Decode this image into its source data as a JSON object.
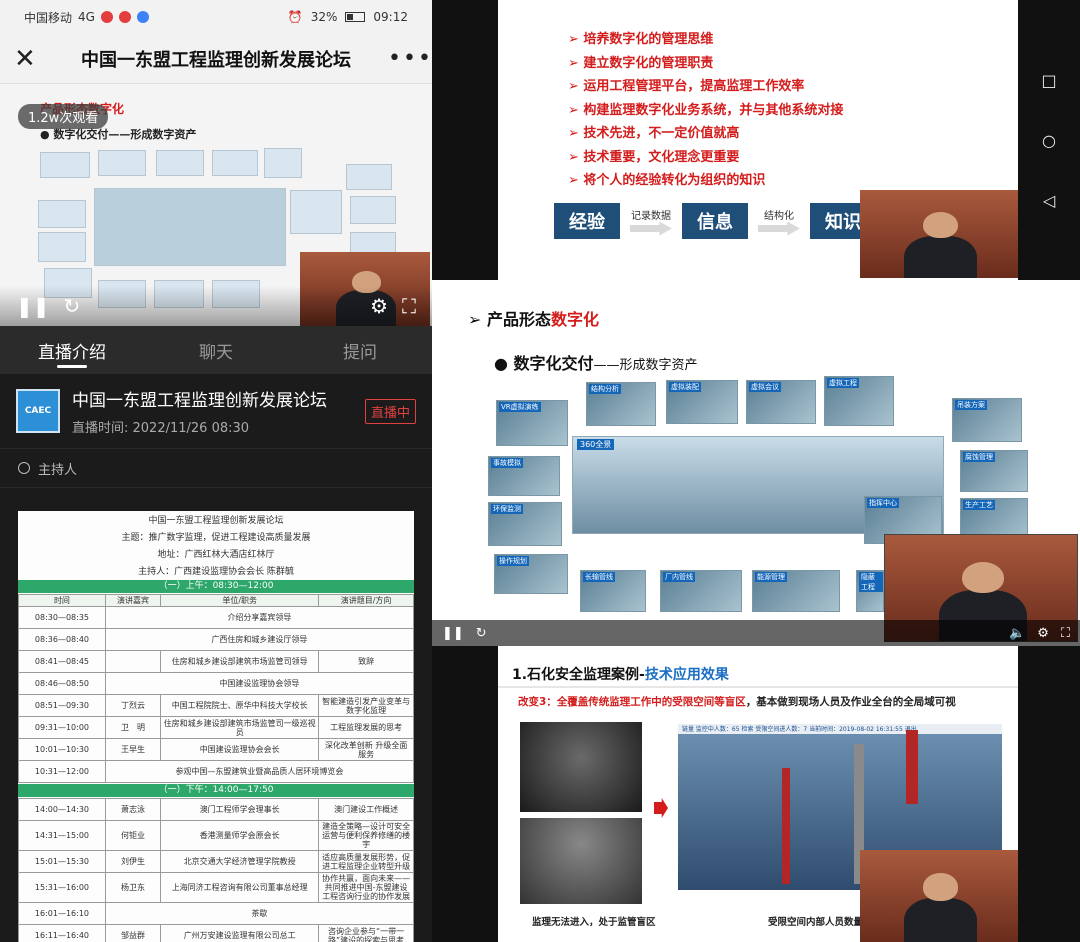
{
  "status_bar": {
    "carrier": "中国移动",
    "network": "4G",
    "battery": "32%",
    "clock": "09:12"
  },
  "header": {
    "title": "中国一东盟工程监理创新发展论坛"
  },
  "video": {
    "views": "1.2w次观看",
    "slide_heading": "产品形态数字化",
    "slide_bullet": "● 数字化交付——形成数字资产"
  },
  "tabs": [
    "直播介绍",
    "聊天",
    "提问"
  ],
  "stream": {
    "logo_text": "CAEC",
    "name": "中国一东盟工程监理创新发展论坛",
    "time": "直播时间: 2022/11/26 08:30",
    "live_badge": "直播中",
    "host_label": "主持人"
  },
  "agenda": {
    "title": "中国一东盟工程监理创新发展论坛",
    "theme": "主题：推广数字监理，促进工程建设高质量发展",
    "venue": "地址：广西红林大酒店红林厅",
    "host": "主持人：广西建设监理协会会长 陈群毓",
    "am_header": "（一）上午：08:30—12:00",
    "pm_header": "（一）下午：14:00—17:50",
    "columns": [
      "时间",
      "演讲嘉宾",
      "单位/职务",
      "演讲题目/方向"
    ],
    "am_rows": [
      [
        "08:30—08:35",
        "",
        "介绍分享嘉宾领导",
        ""
      ],
      [
        "08:36—08:40",
        "",
        "广西住房和城乡建设厅领导",
        ""
      ],
      [
        "08:41—08:45",
        "",
        "住房和城乡建设部建筑市场监管司领导",
        "致辞"
      ],
      [
        "08:46—08:50",
        "",
        "中国建设监理协会领导",
        ""
      ],
      [
        "08:51—09:30",
        "丁烈云",
        "中国工程院院士、原华中科技大学校长",
        "智能建造引发产业变革与数字化监理"
      ],
      [
        "09:31—10:00",
        "卫　明",
        "住房和城乡建设部建筑市场监管司一级巡视员",
        "工程监理发展的思考"
      ],
      [
        "10:01—10:30",
        "王早生",
        "中国建设监理协会会长",
        "深化改革创新 升级全面服务"
      ],
      [
        "10:31—12:00",
        "",
        "参观中国—东盟建筑业暨高品质人居环境博览会",
        ""
      ]
    ],
    "pm_rows": [
      [
        "14:00—14:30",
        "萧志泳",
        "澳门工程师学会理事长",
        "澳门建设工作概述"
      ],
      [
        "14:31—15:00",
        "何钜业",
        "香港测量师学会原会长",
        "建造全策略—设计可安全运营与便利保养修缮的楼宇"
      ],
      [
        "15:01—15:30",
        "刘伊生",
        "北京交通大学经济管理学院教授",
        "适应高质量发展形势，促进工程监理企业转型升级"
      ],
      [
        "15:31—16:00",
        "杨卫东",
        "上海同济工程咨询有限公司董事总经理",
        "协作共赢，面向未来——共同推进中国-东盟建设工程咨询行业的协作发展"
      ],
      [
        "16:01—16:10",
        "",
        "茶歇",
        ""
      ],
      [
        "16:11—16:40",
        "邹益群",
        "广州万安建设监理有限公司总工",
        "咨询企业参与“一带一路”建设的探索与思考"
      ]
    ]
  },
  "slide1": {
    "bullets": [
      "培养数字化的管理思维",
      "建立数字化的管理职责",
      "运用工程管理平台，提高监理工作效率",
      "构建监理数字化业务系统，并与其他系统对接",
      "技术先进，不一定价值就高",
      "技术重要，文化理念更重要",
      "将个人的经验转化为组织的知识"
    ],
    "flow": [
      {
        "box": "经验",
        "arrow": "记录数据"
      },
      {
        "box": "信息",
        "arrow": "结构化"
      },
      {
        "box": "知识",
        "arrow": ""
      }
    ]
  },
  "slide2": {
    "heading_prefix": "➢ 产品形态",
    "heading_red": "数字化",
    "sub_bold": "● 数字化交付",
    "sub_rest": "——形成数字资产",
    "tiles": [
      "VR虚拟演练",
      "结构分析",
      "虚拟装配",
      "虚拟会议",
      "虚拟工程",
      "吊装方案",
      "事故模拟",
      "360全景",
      "腐蚀管理",
      "环保监测",
      "指挥中心",
      "生产工艺",
      "操作规划",
      "长输管线",
      "厂内管线",
      "能源管理",
      "隐蔽工程"
    ]
  },
  "slide3": {
    "heading": "1.石化安全监理案例-",
    "heading_blue": "技术应用效果",
    "change_prefix": "改变3：",
    "change_red": "全覆盖传统监理工作中的受限空间等盲区",
    "change_rest": "，基本做到现场人员及作业全台的全局域可视",
    "hud": "链量  监控中人数：65  检索  受限空间进人数：7  当前时间：2019-08-02 16:31:55  退出  ",
    "caption_left": "监理无法进入，处于监管盲区",
    "caption_right": "受限空间内部人员数量及"
  },
  "android_nav": [
    "□",
    "○",
    "◁"
  ]
}
